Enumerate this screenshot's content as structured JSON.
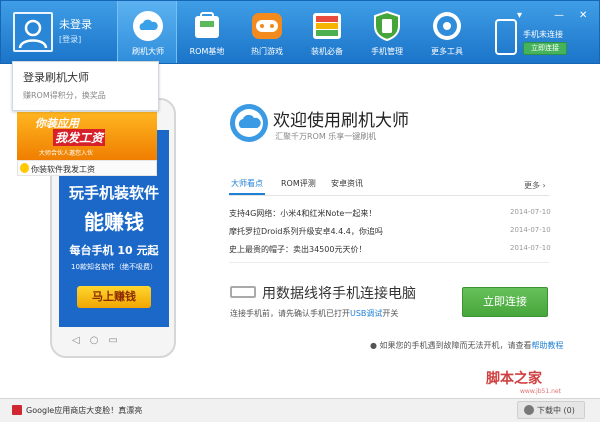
{
  "user": {
    "name": "未登录",
    "login_link": "[登录]"
  },
  "login_popup": {
    "title": "登录刷机大师",
    "subtitle": "赚ROM得积分，换奖品"
  },
  "nav": [
    {
      "label": "刷机大师",
      "icon": "cloud-icon",
      "color": "#3aa0e8"
    },
    {
      "label": "ROM基地",
      "icon": "rom-bag-icon",
      "color": "#ffffff"
    },
    {
      "label": "热门游戏",
      "icon": "gamepad-icon",
      "color": "#f08a1a"
    },
    {
      "label": "装机必备",
      "icon": "apps-box-icon",
      "color": "#4caf50"
    },
    {
      "label": "手机管理",
      "icon": "shield-icon",
      "color": "#45a53a"
    },
    {
      "label": "更多工具",
      "icon": "tools-icon",
      "color": "#3aa0e8"
    }
  ],
  "phone_connect": {
    "label": "手机未连接",
    "button": "立即连接"
  },
  "window_controls": {
    "dropdown": "▾",
    "minimize": "—",
    "close": "✕"
  },
  "promo": {
    "line1": "你装应用",
    "line2": "我发工资",
    "line3": "大师合伙人邀您入伙",
    "caption": "你装软件我发工资"
  },
  "phone_ad": {
    "line1": "玩手机装软件",
    "line2": "能赚钱",
    "line3": "每台手机 10 元起",
    "line4": "10款知名软件（绝不吸费）",
    "button": "马上赚钱",
    "nav_icons": "◁　○　▭"
  },
  "welcome": {
    "title": "欢迎使用刷机大师",
    "subtitle": "汇聚千万ROM 乐享一键刷机"
  },
  "tabs": [
    {
      "label": "大师看点",
      "active": true
    },
    {
      "label": "ROM评测",
      "active": false
    },
    {
      "label": "安卓资讯",
      "active": false
    }
  ],
  "more_link": "更多 ›",
  "news": [
    {
      "title": "支持4G网络：小米4和红米Note一起来！",
      "date": "2014-07-10"
    },
    {
      "title": "摩托罗拉Droid系列升级安卓4.4.4，你追吗",
      "date": "2014-07-10"
    },
    {
      "title": "史上最贵的帽子：卖出34500元天价！",
      "date": "2014-07-10"
    }
  ],
  "connect": {
    "title": "用数据线将手机连接电脑",
    "desc_prefix": "连接手机前，请先确认手机已打开",
    "usb_link": "USB调试",
    "desc_suffix": "开关",
    "button": "立即连接"
  },
  "help": {
    "prefix": "如果您的手机遇到故障而无法开机，请查看",
    "link": "帮助教程"
  },
  "footer": {
    "promo": "Google应用商店大变脸！真漂亮",
    "download": "下载中 (0)"
  },
  "watermark": {
    "text": "脚本之家",
    "url": "www.jb51.net"
  }
}
